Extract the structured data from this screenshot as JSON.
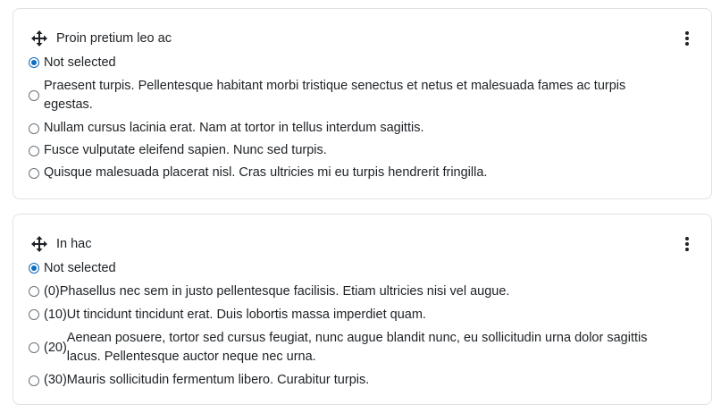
{
  "cards": [
    {
      "title": "Proin pretium leo ac",
      "options": [
        {
          "score": "",
          "text": "Not selected",
          "selected": true
        },
        {
          "score": "",
          "text": "Praesent turpis. Pellentesque habitant morbi tristique senectus et netus et malesuada fames ac turpis egestas.",
          "selected": false
        },
        {
          "score": "",
          "text": "Nullam cursus lacinia erat. Nam at tortor in tellus interdum sagittis.",
          "selected": false
        },
        {
          "score": "",
          "text": "Fusce vulputate eleifend sapien. Nunc sed turpis.",
          "selected": false
        },
        {
          "score": "",
          "text": "Quisque malesuada placerat nisl. Cras ultricies mi eu turpis hendrerit fringilla.",
          "selected": false
        }
      ]
    },
    {
      "title": "In hac",
      "options": [
        {
          "score": "",
          "text": "Not selected",
          "selected": true
        },
        {
          "score": "(0)",
          "text": "Phasellus nec sem in justo pellentesque facilisis. Etiam ultricies nisi vel augue.",
          "selected": false
        },
        {
          "score": "(10)",
          "text": "Ut tincidunt tincidunt erat. Duis lobortis massa imperdiet quam.",
          "selected": false
        },
        {
          "score": "(20)",
          "text": "Aenean posuere, tortor sed cursus feugiat, nunc augue blandit nunc, eu sollicitudin urna dolor sagittis lacus. Pellentesque auctor neque nec urna.",
          "selected": false
        },
        {
          "score": "(30)",
          "text": "Mauris sollicitudin fermentum libero. Curabitur turpis.",
          "selected": false
        }
      ]
    }
  ],
  "icons": {
    "move": "move-icon",
    "menu": "vertical-ellipsis-icon"
  },
  "colors": {
    "accent": "#0f6cbf",
    "border": "#dee2e6",
    "text": "#1d2125"
  }
}
